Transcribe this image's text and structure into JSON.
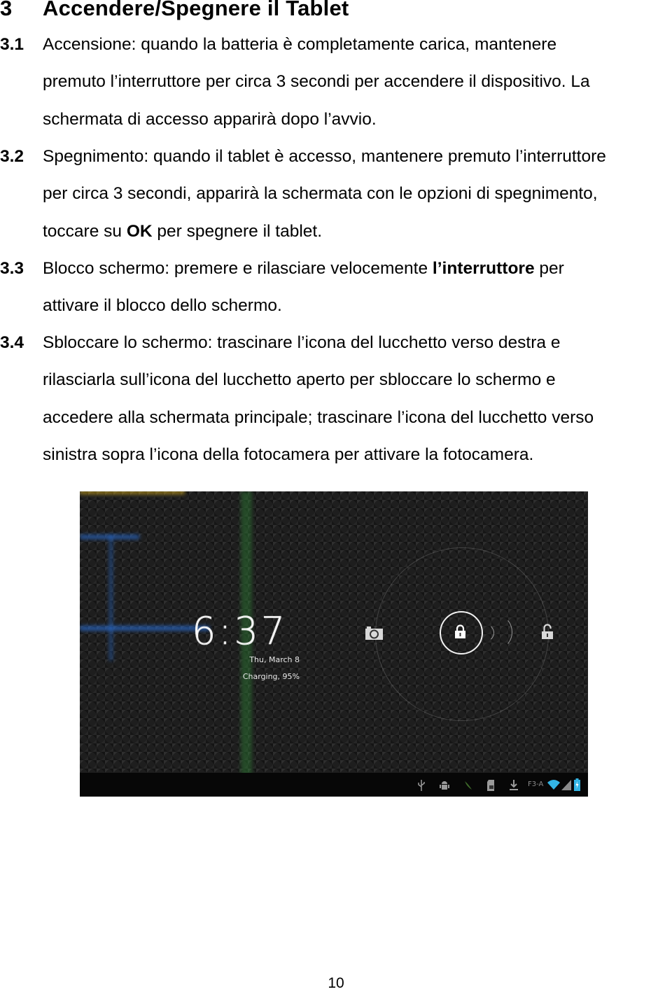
{
  "heading": {
    "number": "3",
    "title": "Accendere/Spegnere il Tablet"
  },
  "sections": [
    {
      "number": "3.1",
      "lines": [
        [
          {
            "t": "Accensione: quando la batteria è completamente carica, mantenere"
          }
        ],
        [
          {
            "t": "premuto l’interruttore per circa 3 secondi per accendere il dispositivo. La"
          }
        ],
        [
          {
            "t": "schermata di accesso apparirà dopo l’avvio."
          }
        ]
      ]
    },
    {
      "number": "3.2",
      "lines": [
        [
          {
            "t": "Spegnimento: quando il tablet è accesso, mantenere premuto l’interruttore"
          }
        ],
        [
          {
            "t": "per circa 3 secondi, apparirà la schermata con le opzioni di spegnimento,"
          }
        ],
        [
          {
            "t": "toccare su "
          },
          {
            "t": "OK",
            "bold": true
          },
          {
            "t": " per spegnere il tablet."
          }
        ]
      ]
    },
    {
      "number": "3.3",
      "lines": [
        [
          {
            "t": "Blocco schermo: premere e rilasciare velocemente "
          },
          {
            "t": "l’interruttore",
            "bold": true
          },
          {
            "t": " per"
          }
        ],
        [
          {
            "t": "attivare il blocco dello schermo."
          }
        ]
      ]
    },
    {
      "number": "3.4",
      "lines": [
        [
          {
            "t": "Sbloccare lo schermo: trascinare l’icona del lucchetto verso destra e"
          }
        ],
        [
          {
            "t": "rilasciarla sull’icona del lucchetto aperto per sbloccare lo schermo e"
          }
        ],
        [
          {
            "t": "accedere alla schermata principale; trascinare l’icona del lucchetto verso"
          }
        ],
        [
          {
            "t": "sinistra sopra l’icona della fotocamera per attivare la fotocamera."
          }
        ]
      ]
    }
  ],
  "lockscreen": {
    "time": "6:37",
    "date": "Thu, March 8",
    "charging": "Charging, 95%",
    "targets": [
      "camera-icon",
      "lock-icon",
      "unlock-icon"
    ],
    "statusbar": {
      "icons": [
        "usb-icon",
        "android-debug-icon",
        "leaf-icon",
        "sd-card-icon",
        "download-icon"
      ],
      "network_label": "F3-A",
      "right_icons": [
        "wifi-icon",
        "signal-icon",
        "battery-charging-icon"
      ]
    },
    "colors": {
      "wifi": "#33b5e5",
      "battery": "#33b5e5",
      "glow_blue": "#2a6fd6",
      "glow_green": "#2e9a3a",
      "glow_yellow": "#c9a21c"
    }
  },
  "page_number": "10"
}
